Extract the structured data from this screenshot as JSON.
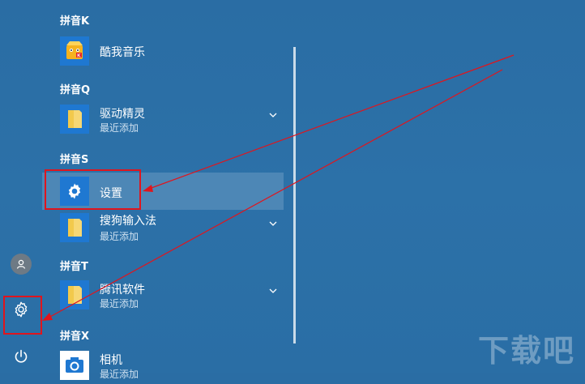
{
  "groups": [
    {
      "header": "拼音K",
      "apps": [
        {
          "name": "酷我音乐",
          "sub": "",
          "icon": "kuwo-music-icon"
        }
      ]
    },
    {
      "header": "拼音Q",
      "apps": [
        {
          "name": "驱动精灵",
          "sub": "最近添加",
          "icon": "folder-icon"
        }
      ]
    },
    {
      "header": "拼音S",
      "apps": [
        {
          "name": "设置",
          "sub": "",
          "icon": "gear-icon"
        },
        {
          "name": "搜狗输入法",
          "sub": "最近添加",
          "icon": "folder-icon"
        }
      ]
    },
    {
      "header": "拼音T",
      "apps": [
        {
          "name": "腾讯软件",
          "sub": "最近添加",
          "icon": "folder-icon"
        }
      ]
    },
    {
      "header": "拼音X",
      "apps": [
        {
          "name": "相机",
          "sub": "最近添加",
          "icon": "camera-icon"
        }
      ]
    }
  ],
  "rail": {
    "icons": [
      "user-avatar-icon",
      "gear-icon",
      "power-icon"
    ]
  },
  "watermark": "下载吧",
  "colors": {
    "annotation_red": "#e0151d",
    "tile_blue": "#1f78d1",
    "folder_yellow": "#f7d774",
    "background": "#2c71a8"
  }
}
